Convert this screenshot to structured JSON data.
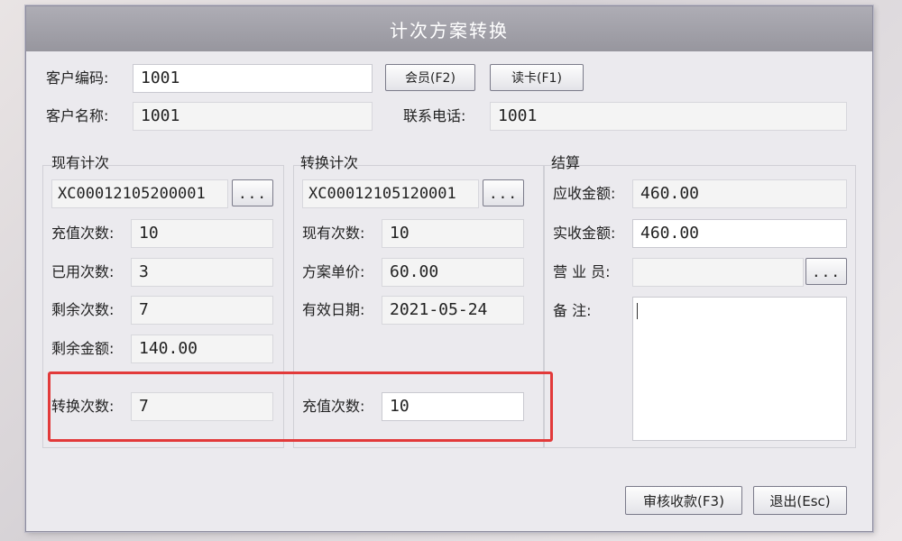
{
  "dialog": {
    "title": "计次方案转换"
  },
  "customer": {
    "code_label": "客户编码:",
    "code_value": "1001",
    "member_button": "会员(F2)",
    "read_card_button": "读卡(F1)",
    "name_label": "客户名称:",
    "name_value": "1001",
    "phone_label": "联系电话:",
    "phone_value": "1001"
  },
  "current": {
    "title": "现有计次",
    "plan_code": "XC00012105200001",
    "browse_label": "...",
    "recharge_label": "充值次数:",
    "recharge_value": "10",
    "used_label": "已用次数:",
    "used_value": "3",
    "remaining_label": "剩余次数:",
    "remaining_value": "7",
    "remaining_amount_label": "剩余金额:",
    "remaining_amount_value": "140.00",
    "convert_label": "转换次数:",
    "convert_value": "7"
  },
  "target": {
    "title": "转换计次",
    "plan_code": "XC00012105120001",
    "browse_label": "...",
    "existing_label": "现有次数:",
    "existing_value": "10",
    "unit_price_label": "方案单价:",
    "unit_price_value": "60.00",
    "valid_date_label": "有效日期:",
    "valid_date_value": "2021-05-24",
    "recharge_label": "充值次数:",
    "recharge_value": "10"
  },
  "settlement": {
    "title": "结算",
    "receivable_label": "应收金额:",
    "receivable_value": "460.00",
    "received_label": "实收金额:",
    "received_value": "460.00",
    "salesperson_label": "营 业 员:",
    "salesperson_value": "",
    "browse_label": "...",
    "remark_label": "备    注:",
    "remark_value": ""
  },
  "footer": {
    "audit_button": "审核收款(F3)",
    "exit_button": "退出(Esc)"
  },
  "colors": {
    "highlight": "#e23a3a",
    "title_bar": "#a3a2aa"
  }
}
